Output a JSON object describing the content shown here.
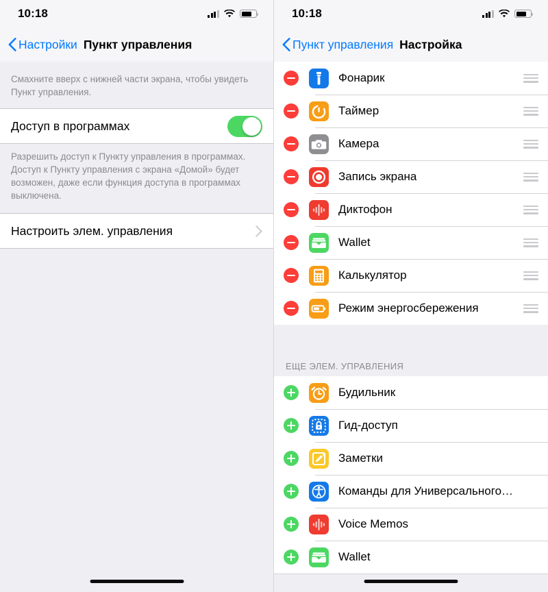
{
  "status_bar": {
    "time": "10:18",
    "signal_icon": "cellular-bars-icon",
    "wifi_icon": "wifi-icon",
    "battery_icon": "battery-icon",
    "battery_level_pct": 72
  },
  "colors": {
    "accent_blue": "#007aff",
    "switch_on_green": "#4cd763",
    "remove_red": "#fc3d39",
    "add_green": "#4cd763",
    "separator": "#c8c7cc",
    "group_background": "#eeeef3",
    "cell_background": "#ffffff",
    "secondary_text": "#8a8a8f"
  },
  "left_screen": {
    "nav": {
      "back_label": "Настройки",
      "back_icon": "chevron-left-icon",
      "title": "Пункт управления"
    },
    "intro_note": "Смахните вверх с нижней части экрана, чтобы увидеть Пункт управления.",
    "access_row": {
      "label": "Доступ в программах",
      "switch_state": "on",
      "switch_value": "Вкл."
    },
    "access_note": "Разрешить доступ к Пункту управления в программах. Доступ к Пункту управления с экрана «Домой» будет возможен, даже если функция доступа в программах выключена.",
    "customize_row": {
      "label": "Настроить элем. управления",
      "disclosure_icon": "chevron-right-icon"
    },
    "home_indicator": "home-indicator"
  },
  "right_screen": {
    "nav": {
      "back_label": "Пункт управления",
      "back_icon": "chevron-left-icon",
      "title": "Настройка"
    },
    "included_section": {
      "header": "",
      "items": [
        {
          "label": "Фонарик",
          "icon": "flashlight-icon",
          "icon_bg": "#1479e8",
          "action_icon": "remove-icon",
          "action": "remove",
          "handle_icon": "reorder-handle-icon"
        },
        {
          "label": "Таймер",
          "icon": "timer-icon",
          "icon_bg": "#f89d16",
          "action_icon": "remove-icon",
          "action": "remove",
          "handle_icon": "reorder-handle-icon"
        },
        {
          "label": "Камера",
          "icon": "camera-icon",
          "icon_bg": "#8e8e93",
          "action_icon": "remove-icon",
          "action": "remove",
          "handle_icon": "reorder-handle-icon"
        },
        {
          "label": "Запись экрана",
          "icon": "screen-record-icon",
          "icon_bg": "#f03a2e",
          "action_icon": "remove-icon",
          "action": "remove",
          "handle_icon": "reorder-handle-icon"
        },
        {
          "label": "Диктофон",
          "icon": "voice-memos-icon",
          "icon_bg": "#ef3b30",
          "action_icon": "remove-icon",
          "action": "remove",
          "handle_icon": "reorder-handle-icon"
        },
        {
          "label": "Wallet",
          "icon": "wallet-icon",
          "icon_bg": "#4cd763",
          "action_icon": "remove-icon",
          "action": "remove",
          "handle_icon": "reorder-handle-icon"
        },
        {
          "label": "Калькулятор",
          "icon": "calculator-icon",
          "icon_bg": "#f89d16",
          "action_icon": "remove-icon",
          "action": "remove",
          "handle_icon": "reorder-handle-icon"
        },
        {
          "label": "Режим энергосбережения",
          "icon": "low-power-mode-icon",
          "icon_bg": "#f89d16",
          "action_icon": "remove-icon",
          "action": "remove",
          "handle_icon": "reorder-handle-icon"
        }
      ]
    },
    "more_section": {
      "header": "ЕЩЕ ЭЛЕМ. УПРАВЛЕНИЯ",
      "items": [
        {
          "label": "Будильник",
          "icon": "alarm-clock-icon",
          "icon_bg": "#f89d16",
          "action_icon": "add-icon",
          "action": "add"
        },
        {
          "label": "Гид-доступ",
          "icon": "guided-access-icon",
          "icon_bg": "#1479e8",
          "action_icon": "add-icon",
          "action": "add"
        },
        {
          "label": "Заметки",
          "icon": "notes-icon",
          "icon_bg": "#fcc82a",
          "action_icon": "add-icon",
          "action": "add"
        },
        {
          "label": "Команды для Универсального…",
          "icon": "accessibility-icon",
          "icon_bg": "#1479e8",
          "action_icon": "add-icon",
          "action": "add"
        },
        {
          "label": "Voice Memos",
          "icon": "voice-memos-icon",
          "icon_bg": "#ef3b30",
          "action_icon": "add-icon",
          "action": "add"
        },
        {
          "label": "Wallet",
          "icon": "wallet-icon",
          "icon_bg": "#4cd763",
          "action_icon": "add-icon",
          "action": "add"
        }
      ]
    },
    "home_indicator": "home-indicator"
  }
}
